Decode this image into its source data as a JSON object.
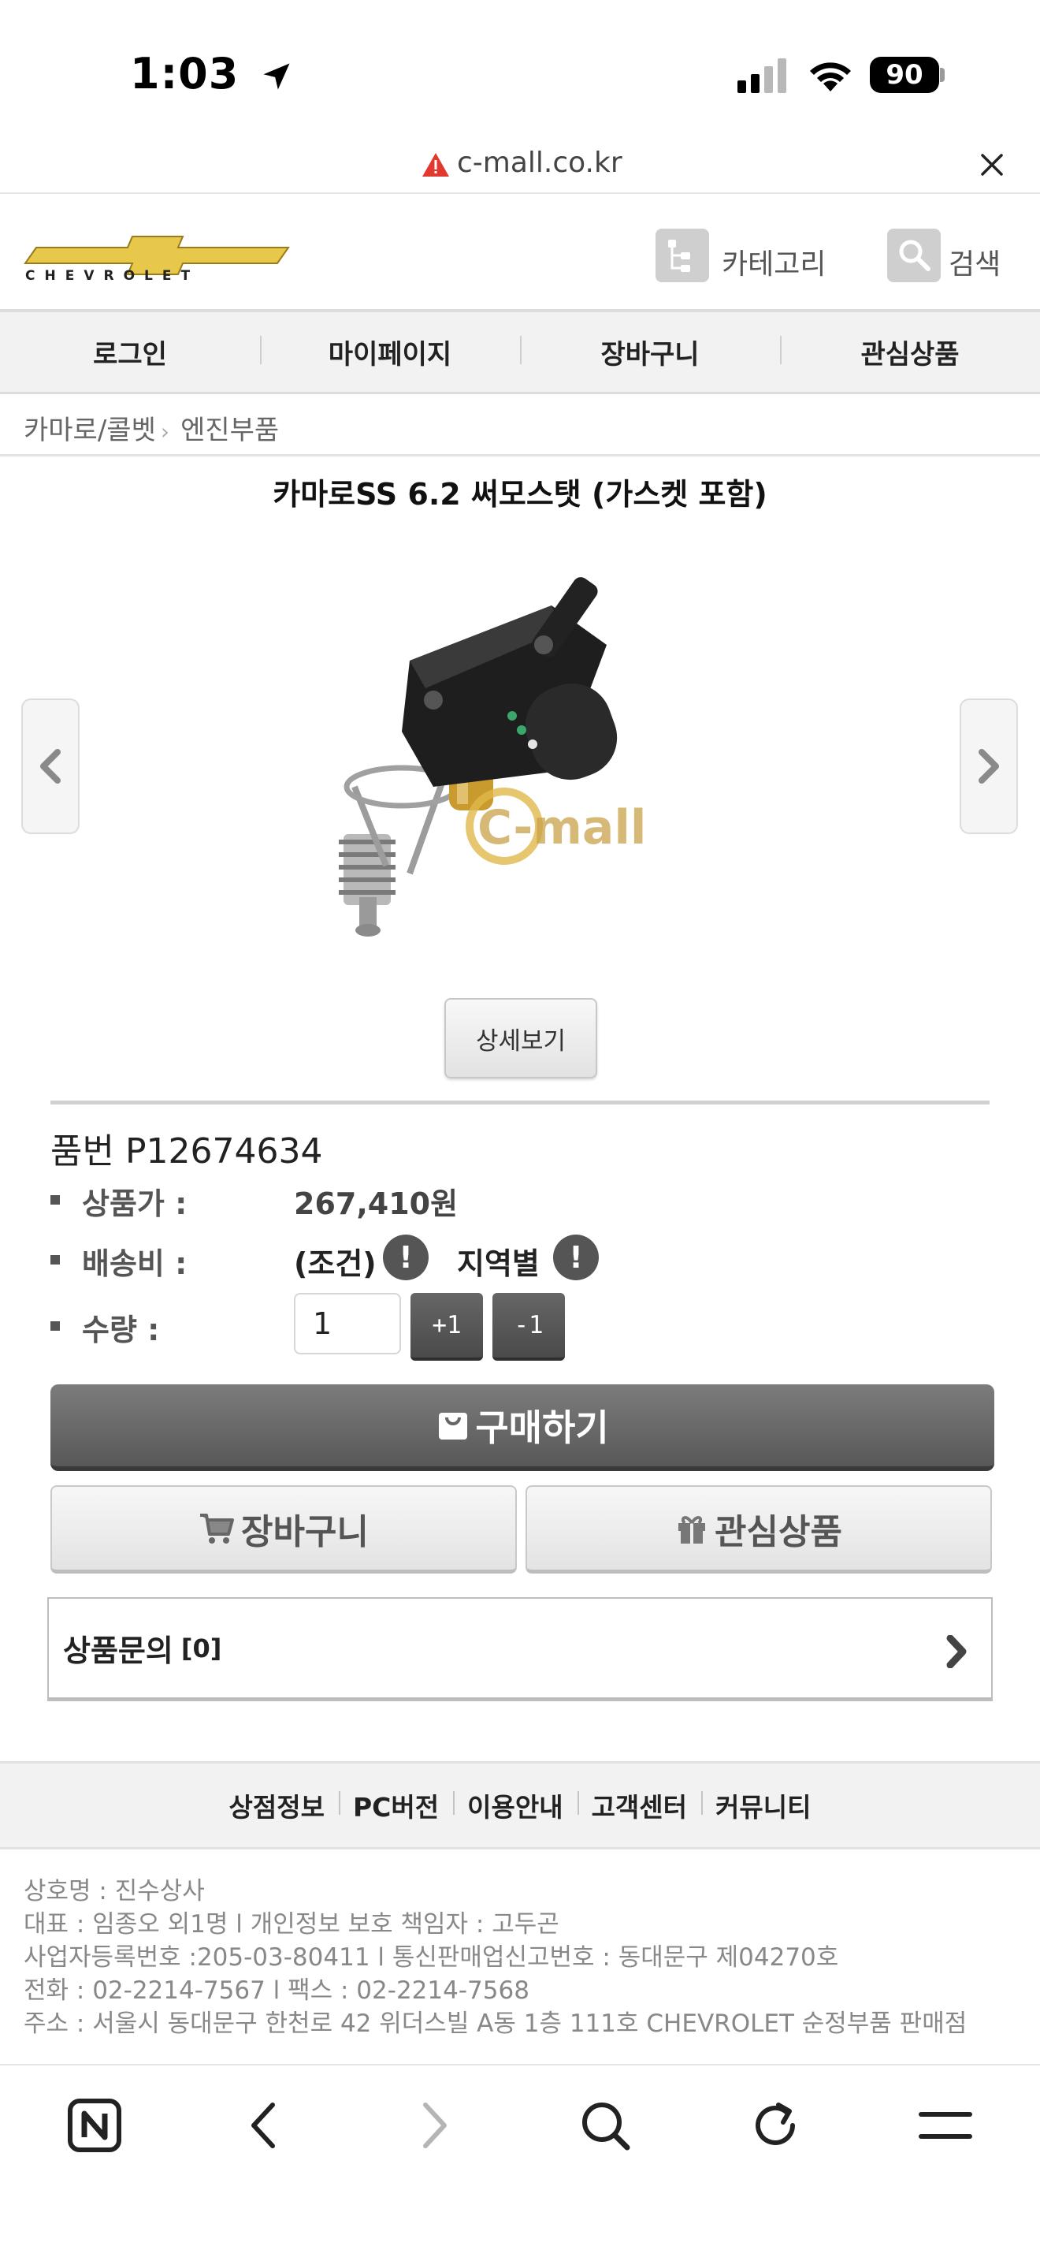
{
  "status_bar": {
    "time": "1:03",
    "battery": "90"
  },
  "url_bar": {
    "domain": "c-mall.co.kr"
  },
  "header": {
    "brand": "CHEVROLET",
    "category_label": "카테고리",
    "search_label": "검색"
  },
  "menu": {
    "items": [
      {
        "label": "로그인"
      },
      {
        "label": "마이페이지"
      },
      {
        "label": "장바구니"
      },
      {
        "label": "관심상품"
      }
    ]
  },
  "breadcrumb": {
    "items": [
      "카마로/콜벳",
      "엔진부품"
    ],
    "separator": "›"
  },
  "product": {
    "title": "카마로SS 6.2 써모스탯 (가스켓 포함)",
    "watermark": "C-mall",
    "detail_button": "상세보기",
    "part_no": "품번 P12674634",
    "price_label": "상품가 :",
    "price_value": "267,410원",
    "shipping_label": "배송비 :",
    "shipping_condition": "(조건)",
    "shipping_region": "지역별",
    "alert_glyph": "!",
    "quantity_label": "수량 :",
    "quantity_value": "1",
    "qty_plus": "+1",
    "qty_minus": "-1",
    "buy_button": "구매하기",
    "cart_button": "장바구니",
    "wish_button": "관심상품",
    "inquiry_label": "상품문의",
    "inquiry_count": "[0]"
  },
  "footer": {
    "nav": [
      "상점정보",
      "PC버전",
      "이용안내",
      "고객센터",
      "커뮤니티"
    ],
    "info": [
      "상호명 : 진수상사",
      "대표 : 임종오 외1명 l 개인정보 보호 책임자 : 고두곤",
      "사업자등록번호 :205-03-80411 l 통신판매업신고번호 : 동대문구 제04270호",
      "전화 : 02-2214-7567 l 팩스 : 02-2214-7568",
      "주소 : 서울시 동대문구 한천로 42 위더스빌 A동 1층 111호 CHEVROLET 순정부품 판매점"
    ]
  },
  "browser_bar": {
    "icons": [
      "n-home-icon",
      "back-icon",
      "forward-icon",
      "search-icon",
      "reload-icon",
      "menu-icon"
    ]
  },
  "colors": {
    "bowtie_gold": "#e8c84a",
    "button_dark": "#5e5e5e",
    "menu_bg": "#f2f2f2"
  }
}
